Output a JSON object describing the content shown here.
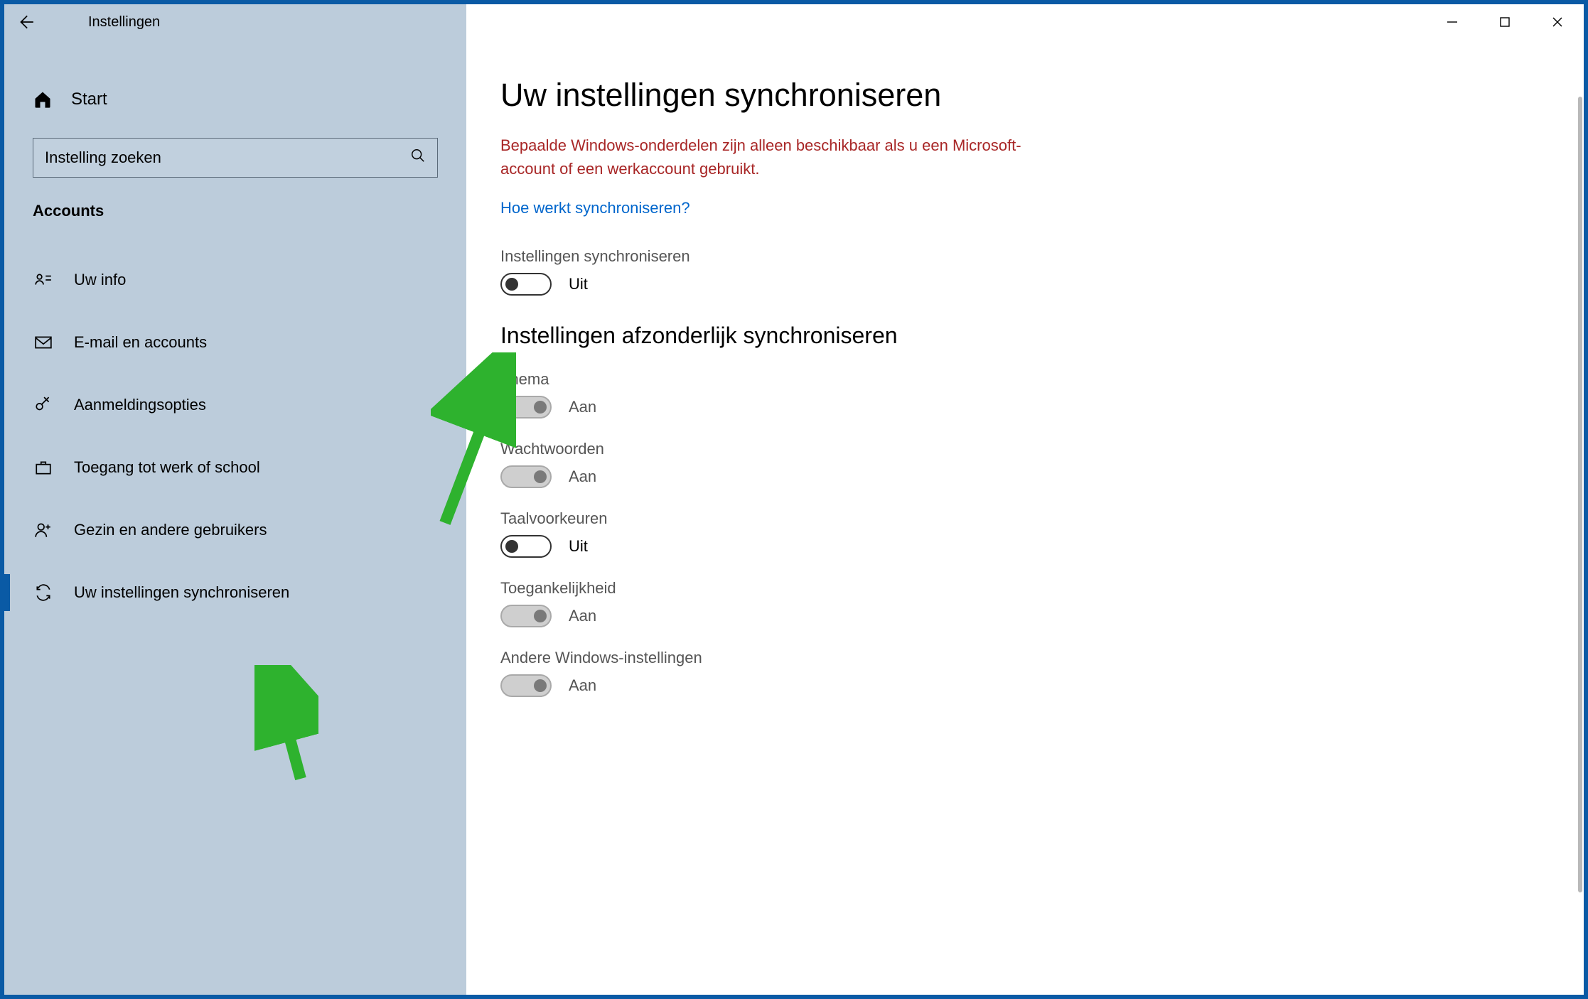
{
  "titlebar": {
    "app_title": "Instellingen"
  },
  "sidebar": {
    "home_label": "Start",
    "search_placeholder": "Instelling zoeken",
    "category": "Accounts",
    "items": [
      {
        "label": "Uw info"
      },
      {
        "label": "E-mail en accounts"
      },
      {
        "label": "Aanmeldingsopties"
      },
      {
        "label": "Toegang tot werk of school"
      },
      {
        "label": "Gezin en andere gebruikers"
      },
      {
        "label": "Uw instellingen synchroniseren"
      }
    ]
  },
  "main": {
    "heading": "Uw instellingen synchroniseren",
    "warning": "Bepaalde Windows-onderdelen zijn alleen beschikbaar als u een Microsoft-account of een werkaccount gebruikt.",
    "help_link": "Hoe werkt synchroniseren?",
    "master": {
      "label": "Instellingen synchroniseren",
      "state_text": "Uit"
    },
    "sub_heading": "Instellingen afzonderlijk synchroniseren",
    "subs": [
      {
        "label": "Thema",
        "state_text": "Aan",
        "on": true,
        "disabled": true
      },
      {
        "label": "Wachtwoorden",
        "state_text": "Aan",
        "on": true,
        "disabled": true
      },
      {
        "label": "Taalvoorkeuren",
        "state_text": "Uit",
        "on": false,
        "disabled": false
      },
      {
        "label": "Toegankelijkheid",
        "state_text": "Aan",
        "on": true,
        "disabled": true
      },
      {
        "label": "Andere Windows-instellingen",
        "state_text": "Aan",
        "on": true,
        "disabled": true
      }
    ]
  }
}
